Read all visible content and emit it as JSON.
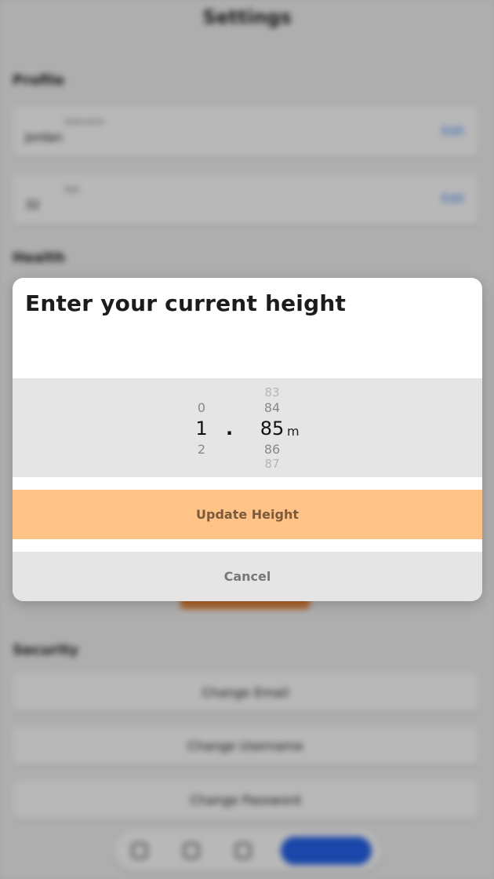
{
  "background": {
    "title": "Settings",
    "sections": {
      "profile": "Profile",
      "health": "Health",
      "security": "Security"
    },
    "profile_cards": [
      {
        "small_label": "Username",
        "value": "Jordan",
        "edit_label": "Edit"
      },
      {
        "small_label": "Age",
        "value": "32",
        "edit_label": "Edit"
      }
    ],
    "security_buttons": [
      "Change Email",
      "Change Username",
      "Change Password"
    ]
  },
  "modal": {
    "title": "Enter your current height",
    "picker": {
      "whole": {
        "above": "0",
        "selected": "1",
        "below": "2"
      },
      "separator": ".",
      "decimal": {
        "far_above": "83",
        "above": "84",
        "selected": "85",
        "below": "86",
        "far_below": "87"
      },
      "unit": "m"
    },
    "update_label": "Update Height",
    "cancel_label": "Cancel"
  },
  "colors": {
    "update_button": "#ffc287",
    "update_text": "#7a5a3a",
    "picker_bg": "#e5e5e5",
    "cancel_text": "#777777"
  }
}
